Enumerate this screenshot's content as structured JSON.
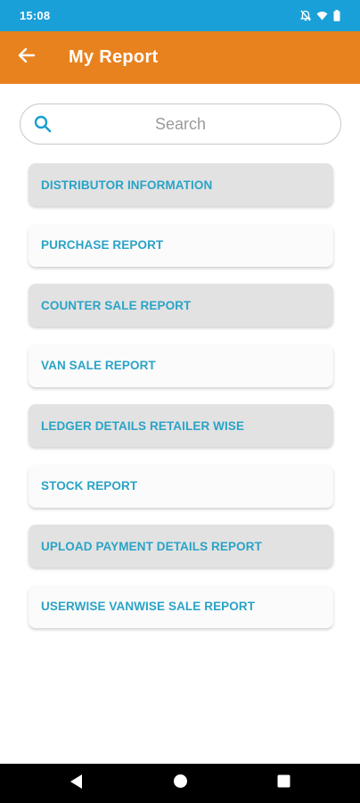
{
  "status_bar": {
    "time": "15:08",
    "icons": [
      "notifications-off-icon",
      "wifi-icon",
      "battery-icon"
    ]
  },
  "app_bar": {
    "back_icon": "arrow-left-icon",
    "title": "My Report",
    "color": "#e8821f"
  },
  "search": {
    "placeholder": "Search",
    "value": "",
    "icon": "search-icon"
  },
  "reports": [
    {
      "label": "DISTRIBUTOR INFORMATION"
    },
    {
      "label": "PURCHASE REPORT"
    },
    {
      "label": "COUNTER SALE REPORT"
    },
    {
      "label": "VAN SALE REPORT"
    },
    {
      "label": "LEDGER DETAILS RETAILER WISE"
    },
    {
      "label": "STOCK REPORT"
    },
    {
      "label": "UPLOAD PAYMENT DETAILS REPORT"
    },
    {
      "label": "USERWISE VANWISE SALE REPORT"
    }
  ],
  "nav_bar": {
    "buttons": [
      "back-triangle-icon",
      "home-circle-icon",
      "recents-square-icon"
    ]
  },
  "colors": {
    "status_bar": "#1aa0d8",
    "accent": "#e8821f",
    "label_text": "#2aa3c6"
  }
}
